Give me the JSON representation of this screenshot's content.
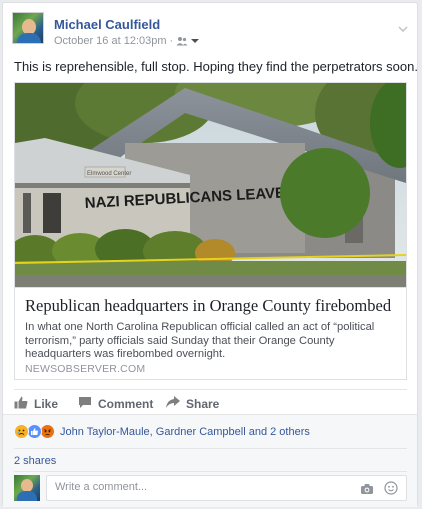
{
  "post": {
    "author": "Michael Caulfield",
    "timestamp": "October 16 at 12:03pm",
    "separator": "·",
    "audience_icon": "friends-icon",
    "status_text": "This is reprehensible, full stop. Hoping they find the perpetrators soon."
  },
  "link": {
    "image_sign_text": "Elmwood Center",
    "graffiti_text": "NAZI REPUBLICANS LEAVE TOWN",
    "headline": "Republican headquarters in Orange County firebombed",
    "description": "In what one North Carolina Republican official called an act of “political terrorism,” party officials said Sunday that their Orange County headquarters was firebombed overnight.",
    "source": "NEWSOBSERVER.COM"
  },
  "actions": {
    "like": "Like",
    "comment": "Comment",
    "share": "Share"
  },
  "reactions": {
    "icons": [
      "sad-emoji",
      "like-emoji",
      "angry-emoji"
    ],
    "names": "John Taylor-Maule, Gardner Campbell and 2 others"
  },
  "shares": "2 shares",
  "comment": {
    "placeholder": "Write a comment...",
    "value": ""
  },
  "colors": {
    "link_blue": "#365899",
    "secondary_text": "#90949c",
    "like_blue": "#5890ff",
    "sad_yellow": "#f7b125",
    "angry_red": "#e9710f"
  }
}
